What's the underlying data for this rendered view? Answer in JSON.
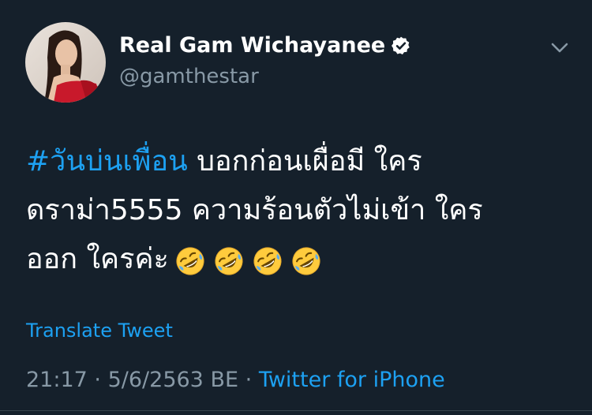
{
  "tweet": {
    "display_name": "Real Gam Wichayanee",
    "handle": "@gamthestar",
    "text": {
      "hashtag": "#วันบ่นเพื่อน",
      "line1_rest": " บอกก่อนเผื่อมี ใคร",
      "line2": "ดราม่า5555 ความร้อนตัวไม่เข้า ใคร",
      "line3": "ออก ใครค่ะ"
    },
    "emojis": [
      "rolling-on-floor-laughing-emoji",
      "rolling-on-floor-laughing-emoji",
      "rolling-on-floor-laughing-emoji",
      "rolling-on-floor-laughing-emoji"
    ],
    "translate_label": "Translate Tweet",
    "time": "21:17",
    "separator": "·",
    "date": "5/6/2563 BE",
    "source": "Twitter for iPhone"
  },
  "icons": {
    "verified": "verified-badge-icon",
    "caret": "chevron-down-icon"
  },
  "colors": {
    "background": "#15202b",
    "accent": "#1da1f2",
    "secondary_text": "#8899a6",
    "primary_text": "#ffffff"
  }
}
